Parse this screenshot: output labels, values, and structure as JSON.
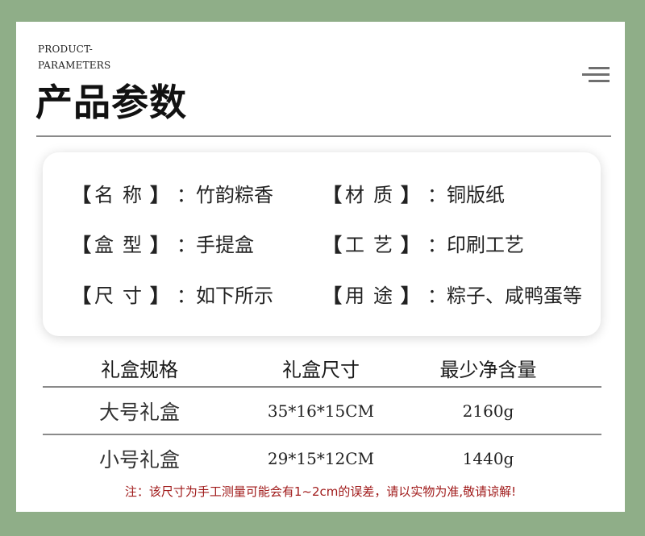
{
  "header": {
    "eyebrow_line1": "PRODUCT-",
    "eyebrow_line2": "PARAMETERS",
    "title": "产品参数"
  },
  "params": {
    "bracket_open": "【",
    "bracket_close": "】",
    "colon": "：",
    "rows": [
      [
        {
          "label": "名称",
          "value": "竹韵粽香"
        },
        {
          "label": "材质",
          "value": "铜版纸"
        }
      ],
      [
        {
          "label": "盒型",
          "value": "手提盒"
        },
        {
          "label": "工艺",
          "value": "印刷工艺"
        }
      ],
      [
        {
          "label": "尺寸",
          "value": "如下所示"
        },
        {
          "label": "用途",
          "value": "粽子、咸鸭蛋等"
        }
      ]
    ]
  },
  "spec_table": {
    "headers": [
      "礼盒规格",
      "礼盒尺寸",
      "最少净含量"
    ],
    "rows": [
      [
        "大号礼盒",
        "35*16*15CM",
        "2160g"
      ],
      [
        "小号礼盒",
        "29*15*12CM",
        "1440g"
      ]
    ]
  },
  "note": "注：该尺寸为手工测量可能会有1~2cm的误差，请以实物为准,敬请谅解!",
  "colors": {
    "background": "#8fae88",
    "note": "#a01a1a"
  },
  "icons": {
    "menu": "menu-lines-icon"
  }
}
